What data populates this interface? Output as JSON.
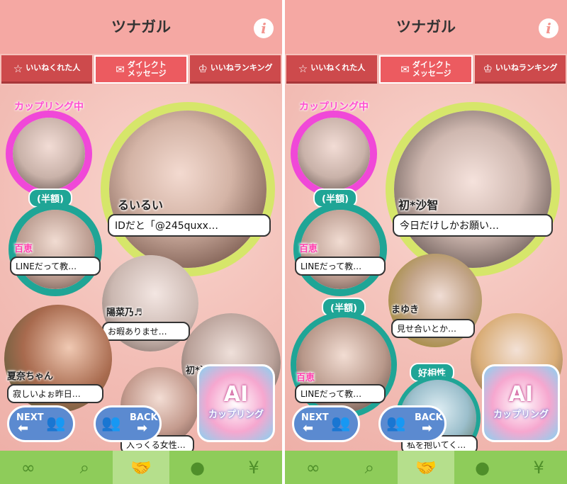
{
  "app": {
    "title": "ツナガル",
    "info_icon": "i"
  },
  "tabs": [
    {
      "label": "いいねくれた人",
      "icon": "star-icon",
      "glyph": "☆"
    },
    {
      "label": "ダイレクト\nメッセージ",
      "icon": "chat-icon",
      "glyph": "✉"
    },
    {
      "label": "いいねランキング",
      "icon": "crown-icon",
      "glyph": "♔"
    }
  ],
  "badges": {
    "coupling": "カップリング中",
    "half": "(半額)",
    "compat": "好相性"
  },
  "left": {
    "feature_name": "るいるい",
    "feature_msg": "IDだと「@245quxx…",
    "p1_name": "百恵",
    "p1_msg": "LINEだって教…",
    "p2_name": "陽菜乃♬",
    "p2_msg": "お暇ありませ…",
    "p3_name": "夏奈ちゃん",
    "p3_msg": "寂しいよぉ昨日…",
    "p4_name": "初*沙智",
    "p5_msg": "入っくる女性…"
  },
  "right": {
    "feature_name": "初*沙智",
    "feature_msg": "今日だけしかお願い…",
    "p1_name": "百恵",
    "p1_msg": "LINEだって教…",
    "p2_name": "まゆき",
    "p2_msg": "見せ合いとか…",
    "p3_name": "百恵",
    "p3_msg": "LINEだって教…",
    "p5_msg": "私を抱いてく…"
  },
  "controls": {
    "next": "NEXT",
    "back": "BACK",
    "ai": "AI",
    "ai_sub": "カップリング"
  },
  "bottom_nav": [
    {
      "icon": "coupling-icon",
      "glyph": "∞"
    },
    {
      "icon": "search-icon",
      "glyph": "⌕"
    },
    {
      "icon": "handshake-icon",
      "glyph": "🤝"
    },
    {
      "icon": "profile-icon",
      "glyph": "●"
    },
    {
      "icon": "points-icon",
      "glyph": "¥"
    }
  ],
  "colors": {
    "header": "#f5a8a3",
    "tab": "#cd4a4c",
    "tab_active": "#ec5b60",
    "accent_teal": "#1fa596",
    "accent_pink": "#ff4fd0",
    "nav_green": "#8ecc5a"
  }
}
